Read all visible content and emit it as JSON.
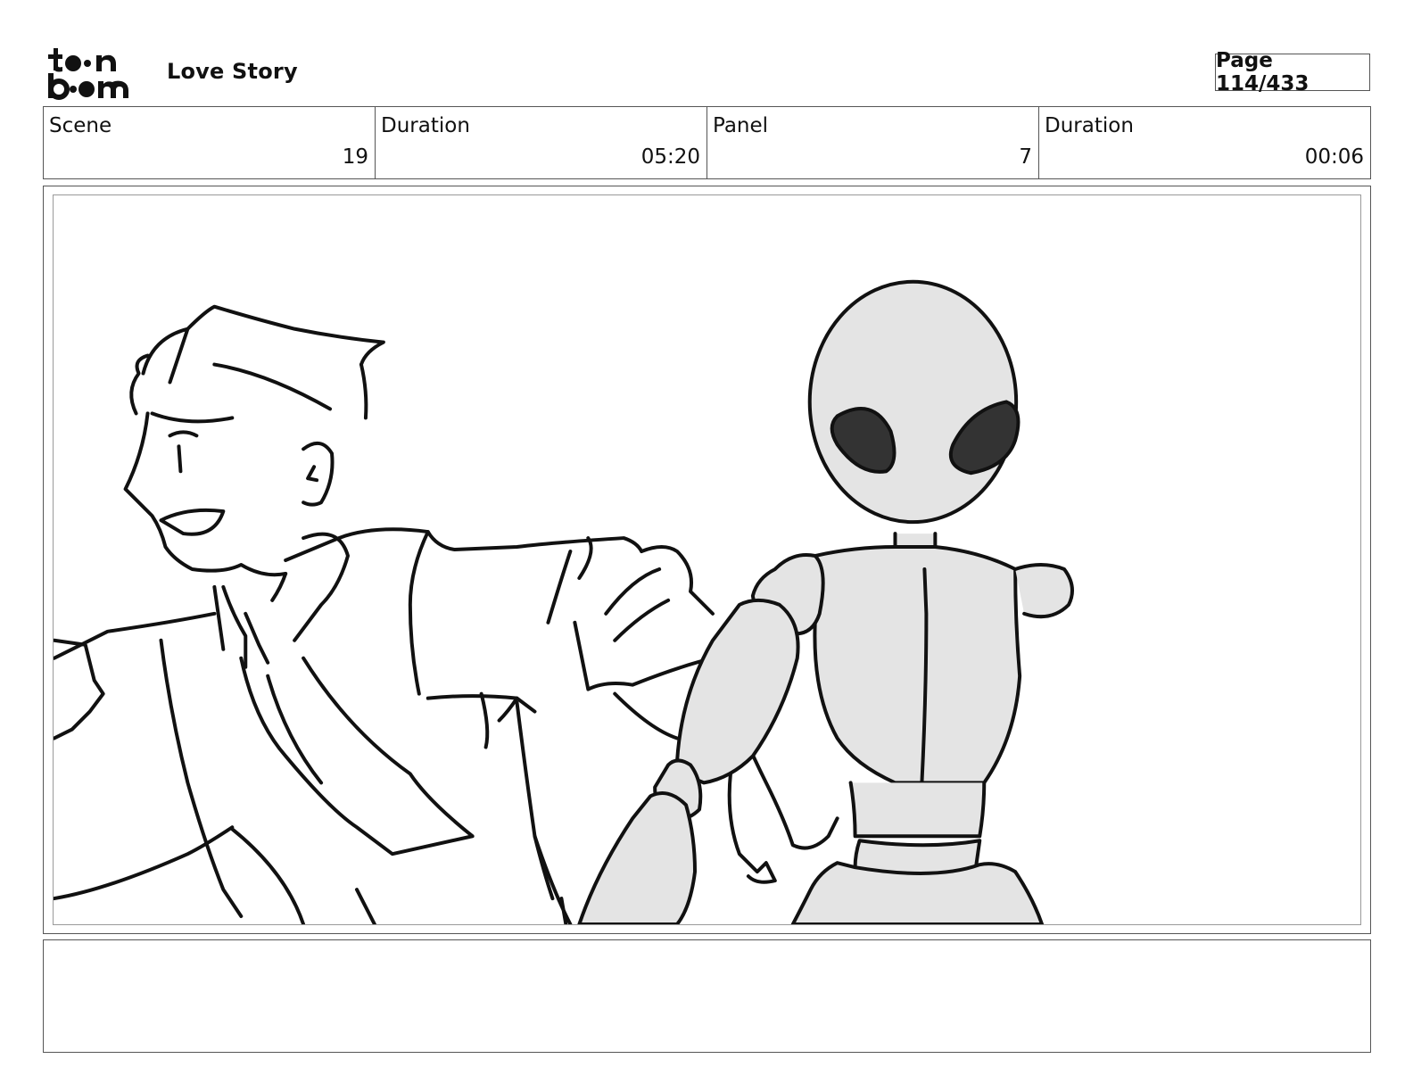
{
  "header": {
    "logo": "toon boom",
    "project_title": "Love Story",
    "page_label": "Page 114/433"
  },
  "info": [
    {
      "label": "Scene",
      "value": "19"
    },
    {
      "label": "Duration",
      "value": "05:20"
    },
    {
      "label": "Panel",
      "value": "7"
    },
    {
      "label": "Duration",
      "value": "00:06"
    }
  ],
  "panel": {
    "image_description": "Sketch of a smiling man in shirt and tie beside a grey alien robot mannequin"
  },
  "notes": {
    "text": ""
  }
}
